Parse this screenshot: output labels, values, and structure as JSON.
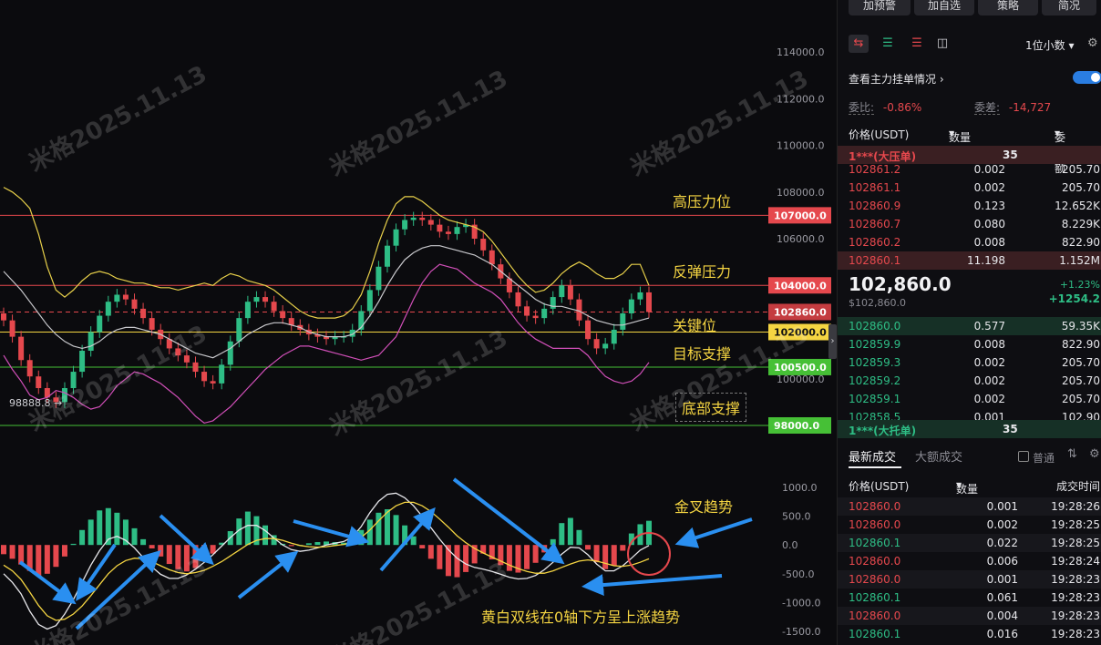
{
  "watermark": "米格2025.11.13",
  "chart_data": {
    "type": "candlestick",
    "y_axis_ticks": [
      "114000.0",
      "112000.0",
      "110000.0",
      "108000.0",
      "106000.0",
      "104000.0",
      "102000.0",
      "100000.0"
    ],
    "macd_axis_ticks": [
      "1000.0",
      "500.0",
      "0.0",
      "-500.0",
      "-1000.0",
      "-1500.0"
    ],
    "levels": [
      {
        "price": 107000,
        "tag": "107000.0",
        "label": "高压力位",
        "color": "#e5484d"
      },
      {
        "price": 104000,
        "tag": "104000.0",
        "label": "反弹压力",
        "color": "#e5484d"
      },
      {
        "price": 102860,
        "tag": "102860.0",
        "label": "关键位",
        "color": "#e5484d"
      },
      {
        "price": 102000,
        "tag": "102000.0",
        "label": "",
        "color": "#f5d542"
      },
      {
        "price": 100500,
        "tag": "100500.0",
        "label": "目标支撑",
        "color": "#46c036"
      },
      {
        "price": 98000,
        "tag": "98000.0",
        "label": "底部支撑",
        "color": "#46c036"
      }
    ],
    "low_marker": "98888.8",
    "macd_label_1": "金叉趋势",
    "macd_label_2": "黄白双线在0轴下方呈上涨趋势",
    "close": [
      102500,
      101800,
      100800,
      100100,
      99600,
      99200,
      99000,
      99600,
      100300,
      101200,
      102000,
      102700,
      103300,
      103600,
      103400,
      103000,
      102600,
      102100,
      101700,
      101300,
      101000,
      100700,
      100300,
      99900,
      99800,
      100600,
      101600,
      102600,
      103300,
      103500,
      103300,
      102900,
      102600,
      102300,
      102100,
      101900,
      101800,
      101700,
      101800,
      101800,
      102100,
      102900,
      103800,
      104800,
      105700,
      106400,
      106800,
      106900,
      106800,
      106600,
      106300,
      106200,
      106500,
      106600,
      106000,
      105500,
      104900,
      104300,
      103700,
      103100,
      102700,
      102600,
      103000,
      103500,
      104000,
      103400,
      102500,
      101700,
      101300,
      101500,
      102100,
      102800,
      103400,
      103700,
      102860
    ],
    "bb_upper": [
      108200,
      108000,
      107700,
      107300,
      106200,
      104800,
      103800,
      103500,
      103800,
      104200,
      104500,
      104600,
      104500,
      104300,
      104200,
      104100,
      104100,
      104000,
      103900,
      103900,
      103800,
      103900,
      104000,
      104100,
      104000,
      104300,
      104500,
      104400,
      104200,
      104100,
      104000,
      103800,
      103500,
      103200,
      102900,
      102700,
      102600,
      102600,
      102600,
      102700,
      103000,
      103600,
      104600,
      105800,
      106800,
      107500,
      107800,
      107800,
      107600,
      107300,
      107000,
      106800,
      106700,
      106600,
      106500,
      106300,
      105900,
      105400,
      104900,
      104400,
      104000,
      103700,
      103800,
      104100,
      104500,
      104800,
      105000,
      104800,
      104500,
      104300,
      104300,
      104500,
      104900,
      104900,
      104000
    ],
    "bb_mid": [
      104600,
      104200,
      103800,
      103300,
      102800,
      102300,
      101900,
      101600,
      101400,
      101300,
      101400,
      101600,
      101900,
      102100,
      102200,
      102200,
      102100,
      102000,
      101900,
      101700,
      101500,
      101300,
      101100,
      101000,
      100900,
      101100,
      101300,
      101600,
      101900,
      102100,
      102300,
      102400,
      102400,
      102300,
      102200,
      102000,
      101900,
      101800,
      101800,
      101800,
      101900,
      102200,
      102700,
      103300,
      104000,
      104600,
      105100,
      105400,
      105600,
      105700,
      105700,
      105600,
      105500,
      105400,
      105300,
      105100,
      104900,
      104600,
      104300,
      104000,
      103700,
      103400,
      103200,
      103100,
      103100,
      103000,
      102900,
      102700,
      102500,
      102400,
      102300,
      102300,
      102400,
      102500,
      102600
    ],
    "bb_lower": [
      101000,
      100400,
      99900,
      99300,
      99100,
      99200,
      99500,
      99400,
      99200,
      98900,
      98700,
      98800,
      99200,
      99700,
      100000,
      100300,
      100200,
      100000,
      99800,
      99500,
      99200,
      98800,
      98400,
      98100,
      98200,
      98500,
      98800,
      99200,
      99600,
      100000,
      100400,
      100700,
      101000,
      101200,
      101400,
      101400,
      101300,
      101200,
      101100,
      101000,
      100900,
      100800,
      100900,
      101000,
      101400,
      101800,
      102600,
      103400,
      104100,
      104600,
      104900,
      104800,
      104700,
      104400,
      104100,
      103900,
      103700,
      103400,
      102900,
      102400,
      102000,
      101700,
      101500,
      101300,
      101300,
      101300,
      101300,
      101000,
      100500,
      100100,
      99900,
      99800,
      99900,
      100200,
      100700
    ],
    "macd_hist": [
      -160,
      -240,
      -340,
      -450,
      -540,
      -500,
      -380,
      -200,
      20,
      260,
      440,
      600,
      640,
      560,
      440,
      290,
      100,
      -60,
      -200,
      -330,
      -420,
      -460,
      -400,
      -290,
      -150,
      40,
      240,
      460,
      580,
      500,
      340,
      170,
      20,
      -20,
      0,
      30,
      50,
      60,
      50,
      40,
      100,
      260,
      440,
      560,
      620,
      520,
      340,
      150,
      -60,
      -240,
      -420,
      -540,
      -560,
      -470,
      -320,
      -150,
      -250,
      -350,
      -450,
      -480,
      -420,
      -310,
      -130,
      100,
      380,
      470,
      260,
      -80,
      -300,
      -420,
      -360,
      -100,
      200,
      360,
      420
    ],
    "macd_dif": [
      -500,
      -650,
      -850,
      -1150,
      -1380,
      -1460,
      -1400,
      -1200,
      -950,
      -650,
      -350,
      -100,
      100,
      150,
      80,
      -50,
      -220,
      -380,
      -510,
      -580,
      -580,
      -520,
      -420,
      -300,
      -170,
      -20,
      130,
      260,
      340,
      340,
      250,
      120,
      0,
      -80,
      -110,
      -90,
      -50,
      0,
      30,
      60,
      140,
      320,
      560,
      760,
      880,
      900,
      820,
      680,
      500,
      300,
      100,
      -80,
      -230,
      -330,
      -390,
      -420,
      -460,
      -510,
      -560,
      -590,
      -580,
      -530,
      -430,
      -300,
      -160,
      -40,
      -50,
      -170,
      -330,
      -450,
      -450,
      -360,
      -230,
      -90,
      -10
    ],
    "macd_dea": [
      -350,
      -450,
      -600,
      -820,
      -1050,
      -1230,
      -1310,
      -1290,
      -1200,
      -1060,
      -880,
      -690,
      -500,
      -360,
      -270,
      -230,
      -240,
      -290,
      -360,
      -430,
      -480,
      -500,
      -480,
      -440,
      -370,
      -290,
      -190,
      -90,
      10,
      80,
      110,
      110,
      80,
      30,
      -10,
      -30,
      -40,
      -30,
      -10,
      10,
      50,
      130,
      260,
      420,
      570,
      680,
      740,
      740,
      680,
      580,
      450,
      310,
      160,
      40,
      -60,
      -140,
      -210,
      -280,
      -350,
      -410,
      -460,
      -490,
      -490,
      -450,
      -390,
      -330,
      -280,
      -260,
      -280,
      -320,
      -360,
      -370,
      -350,
      -300,
      -240
    ]
  },
  "panel": {
    "top_buttons": [
      "加预警",
      "加自选",
      "策略",
      "简况"
    ],
    "precision": "1位小数",
    "check_main": "查看主力挂单情况",
    "ratio_label": "委比:",
    "ratio_value": "-0.86%",
    "diff_label": "委差:",
    "diff_value": "-14,727",
    "col_price": "价格(USDT)",
    "col_qty": "数量 (BTC)",
    "col_amount": "委托额",
    "ask_big": {
      "label": "1***(大压单)",
      "qty": "35"
    },
    "asks": [
      {
        "price": "102861.2",
        "qty": "0.002",
        "amount": "205.70"
      },
      {
        "price": "102861.1",
        "qty": "0.002",
        "amount": "205.70"
      },
      {
        "price": "102860.9",
        "qty": "0.123",
        "amount": "12.652K"
      },
      {
        "price": "102860.7",
        "qty": "0.080",
        "amount": "8.229K"
      },
      {
        "price": "102860.2",
        "qty": "0.008",
        "amount": "822.90"
      },
      {
        "price": "102860.1",
        "qty": "11.198",
        "amount": "1.152M"
      }
    ],
    "last_price": "102,860.0",
    "last_price_sub": "$102,860.0",
    "change_pct": "+1.23%",
    "change_abs": "+1254.2",
    "bids": [
      {
        "price": "102860.0",
        "qty": "0.577",
        "amount": "59.35K"
      },
      {
        "price": "102859.9",
        "qty": "0.008",
        "amount": "822.90"
      },
      {
        "price": "102859.3",
        "qty": "0.002",
        "amount": "205.70"
      },
      {
        "price": "102859.2",
        "qty": "0.002",
        "amount": "205.70"
      },
      {
        "price": "102859.1",
        "qty": "0.002",
        "amount": "205.70"
      },
      {
        "price": "102858.5",
        "qty": "0.001",
        "amount": "102.90"
      }
    ],
    "bid_big": {
      "label": "1***(大托单)",
      "qty": "35"
    },
    "trades_tab1": "最新成交",
    "trades_tab2": "大额成交",
    "normal_label": "普通",
    "trade_col_price": "价格(USDT)",
    "trade_col_qty": "数量(BTC)",
    "trade_col_time": "成交时间",
    "trades": [
      {
        "price": "102860.0",
        "qty": "0.001",
        "time": "19:28:26",
        "side": "sell"
      },
      {
        "price": "102860.0",
        "qty": "0.002",
        "time": "19:28:25",
        "side": "sell"
      },
      {
        "price": "102860.1",
        "qty": "0.022",
        "time": "19:28:25",
        "side": "buy"
      },
      {
        "price": "102860.0",
        "qty": "0.006",
        "time": "19:28:24",
        "side": "sell"
      },
      {
        "price": "102860.0",
        "qty": "0.001",
        "time": "19:28:23",
        "side": "sell"
      },
      {
        "price": "102860.1",
        "qty": "0.061",
        "time": "19:28:23",
        "side": "buy"
      },
      {
        "price": "102860.0",
        "qty": "0.004",
        "time": "19:28:23",
        "side": "sell"
      },
      {
        "price": "102860.1",
        "qty": "0.016",
        "time": "19:28:23",
        "side": "buy"
      }
    ]
  }
}
